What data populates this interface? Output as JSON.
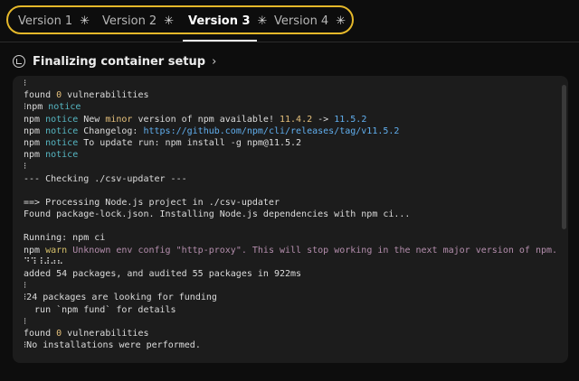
{
  "tabs": [
    {
      "label": "Version 1",
      "spinner": "✳"
    },
    {
      "label": "Version 2",
      "spinner": "✳"
    },
    {
      "label": "Version 3",
      "spinner": "✳"
    },
    {
      "label": "Version 4",
      "spinner": "✳"
    }
  ],
  "active_tab": "Version 3",
  "highlight_color": "#e5b82a",
  "setup": {
    "title": "Finalizing container setup",
    "chevron": "›"
  },
  "log": [
    {
      "segments": [
        {
          "t": "⁝"
        }
      ]
    },
    {
      "segments": [
        {
          "t": "found "
        },
        {
          "t": "0",
          "c": "num"
        },
        {
          "t": " vulnerabilities"
        }
      ]
    },
    {
      "segments": [
        {
          "t": "⁝npm "
        },
        {
          "t": "notice",
          "c": "cyan"
        }
      ]
    },
    {
      "segments": [
        {
          "t": "npm "
        },
        {
          "t": "notice",
          "c": "cyan"
        },
        {
          "t": " New "
        },
        {
          "t": "minor",
          "c": "num"
        },
        {
          "t": " version of npm available! "
        },
        {
          "t": "11.4.2",
          "c": "num"
        },
        {
          "t": " -> "
        },
        {
          "t": "11.5.2",
          "c": "link"
        }
      ]
    },
    {
      "segments": [
        {
          "t": "npm "
        },
        {
          "t": "notice",
          "c": "cyan"
        },
        {
          "t": " Changelog: "
        },
        {
          "t": "https://github.com/npm/cli/releases/tag/v11.5.2",
          "c": "link"
        }
      ]
    },
    {
      "segments": [
        {
          "t": "npm "
        },
        {
          "t": "notice",
          "c": "cyan"
        },
        {
          "t": " To update run: npm install -g npm@11.5.2"
        }
      ]
    },
    {
      "segments": [
        {
          "t": "npm "
        },
        {
          "t": "notice",
          "c": "cyan"
        }
      ]
    },
    {
      "segments": [
        {
          "t": "⁝"
        }
      ]
    },
    {
      "segments": [
        {
          "t": "--- Checking ./csv-updater ---"
        }
      ]
    },
    {
      "segments": [
        {
          "t": ""
        }
      ]
    },
    {
      "segments": [
        {
          "t": "==> Processing Node.js project in ./csv-updater"
        }
      ]
    },
    {
      "segments": [
        {
          "t": "Found package-lock.json. Installing Node.js dependencies with npm ci..."
        }
      ]
    },
    {
      "segments": [
        {
          "t": ""
        }
      ]
    },
    {
      "segments": [
        {
          "t": "Running: npm ci"
        }
      ]
    },
    {
      "segments": [
        {
          "t": "npm "
        },
        {
          "t": "warn",
          "c": "warn"
        },
        {
          "t": " Unknown env config \"http-proxy\". This will stop working in the next major version of npm.",
          "c": "purple"
        }
      ]
    },
    {
      "segments": [
        {
          "t": "⠙⠹⠸⠼⠴⠦"
        }
      ]
    },
    {
      "segments": [
        {
          "t": "added 54 packages, and audited 55 packages in 922ms"
        }
      ]
    },
    {
      "segments": [
        {
          "t": "⁝"
        }
      ]
    },
    {
      "segments": [
        {
          "t": "⁝24 packages are looking for funding"
        }
      ]
    },
    {
      "segments": [
        {
          "t": "  run `npm fund` for details"
        }
      ]
    },
    {
      "segments": [
        {
          "t": "⁝"
        }
      ]
    },
    {
      "segments": [
        {
          "t": "found "
        },
        {
          "t": "0",
          "c": "num"
        },
        {
          "t": " vulnerabilities"
        }
      ]
    },
    {
      "segments": [
        {
          "t": "⁝No installations were performed."
        }
      ]
    }
  ]
}
